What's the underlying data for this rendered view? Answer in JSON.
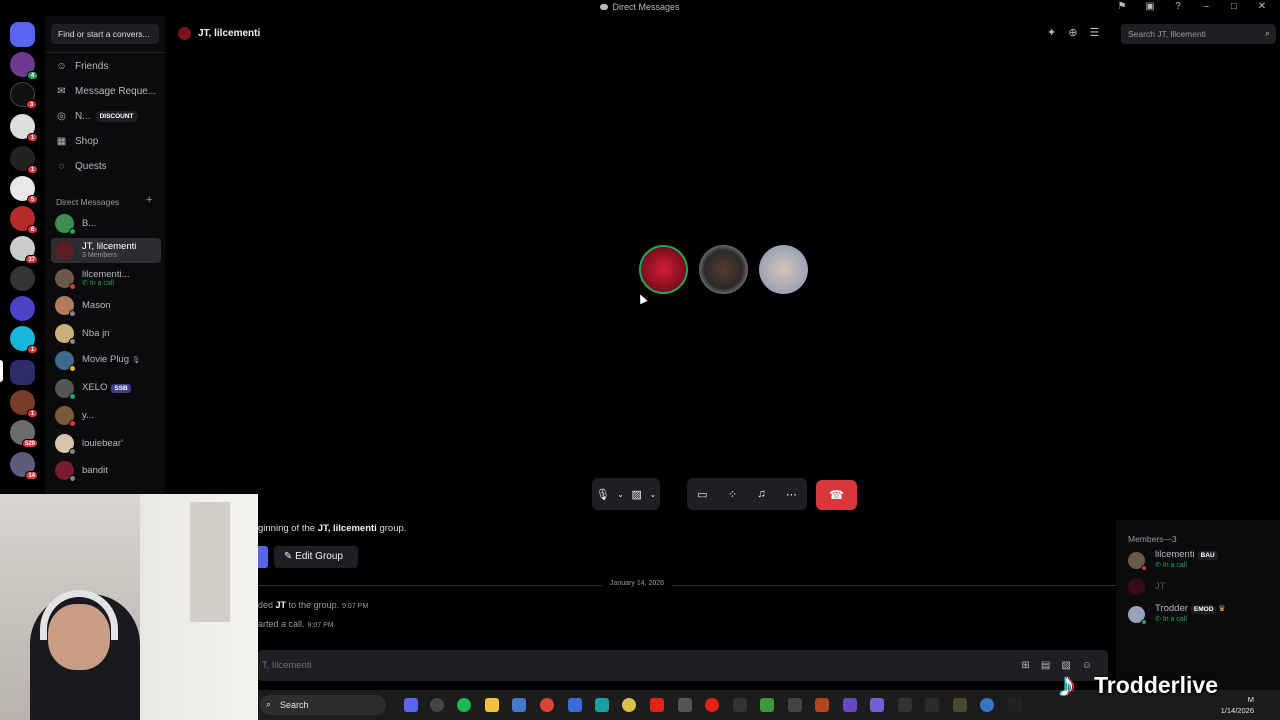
{
  "window": {
    "title": "Direct Messages"
  },
  "sidebar": {
    "find_placeholder": "Find or start a convers...",
    "nav": [
      {
        "label": "Friends",
        "icon": "person-wave-icon"
      },
      {
        "label": "Message Reque...",
        "icon": "envelope-icon"
      },
      {
        "label": "N...",
        "icon": "nitro-icon",
        "badge": "DISCOUNT"
      },
      {
        "label": "Shop",
        "icon": "shop-icon"
      },
      {
        "label": "Quests",
        "icon": "quests-icon"
      }
    ],
    "dm_header": "Direct Messages",
    "dms": [
      {
        "name": "B...",
        "sub": ""
      },
      {
        "name": "JT, lilcementi",
        "sub": "3 Members"
      },
      {
        "name": "lilcementi...",
        "sub": "In a call"
      },
      {
        "name": "Mason",
        "sub": ""
      },
      {
        "name": "Nba jn",
        "sub": ""
      },
      {
        "name": "Movie Plug",
        "sub": ""
      },
      {
        "name": "XELO",
        "sub": "",
        "tag": "SSB"
      },
      {
        "name": "y...",
        "sub": ""
      },
      {
        "name": "louiebear'",
        "sub": ""
      },
      {
        "name": "bandit",
        "sub": ""
      }
    ],
    "rail_badges": [
      "3",
      "1",
      "1",
      "5",
      "6",
      "37",
      "1",
      "1",
      "37",
      "529",
      "14"
    ]
  },
  "header": {
    "group_name": "JT, lilcementi",
    "search_placeholder": "Search JT, lilcementi"
  },
  "chat": {
    "intro_pre": "ginning of the ",
    "intro_group": "JT, lilcementi",
    "intro_post": " group.",
    "edit_group": "Edit Group",
    "date_divider": "January 14, 2026",
    "msg1_pre": "ded ",
    "msg1_name": "JT",
    "msg1_post": " to the group.",
    "msg1_time": "9:07 PM",
    "msg2": "arted a call.",
    "msg2_time": "9:07 PM",
    "input_placeholder": "T, lilcementi"
  },
  "members": {
    "header": "Members—3",
    "list": [
      {
        "name": "lilcementi",
        "tag": "BAU",
        "sub": "In a call"
      },
      {
        "name": "JT",
        "tag": "",
        "sub": ""
      },
      {
        "name": "Trodder",
        "tag": "EMOD",
        "sub": "In a call"
      }
    ]
  },
  "taskbar": {
    "search": "Search",
    "clock_top": "M",
    "clock_date": "1/14/2026"
  },
  "watermark": {
    "text": "Trodderlive"
  },
  "colors": {
    "accent": "#5865f2",
    "danger": "#da373c",
    "online": "#23a55a"
  }
}
